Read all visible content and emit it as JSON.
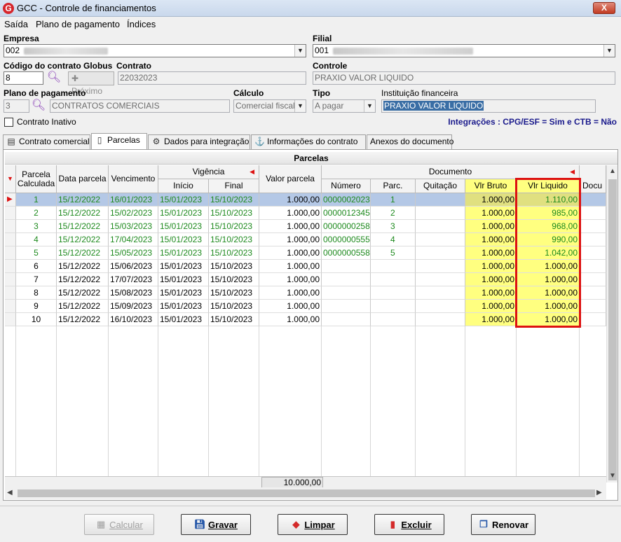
{
  "window": {
    "title": "GCC - Controle de financiamentos",
    "close_label": "X"
  },
  "menu": [
    {
      "label": "Saída"
    },
    {
      "label": "Plano de pagamento"
    },
    {
      "label": "Índices"
    }
  ],
  "form": {
    "empresa_label": "Empresa",
    "empresa_value": "002",
    "filial_label": "Filial",
    "filial_value": "001",
    "codigo_label": "Código do contrato Globus",
    "codigo_value": "8",
    "proximo_label": "Próximo",
    "contrato_label": "Contrato",
    "contrato_value": "22032023",
    "controle_label": "Controle",
    "controle_value": "PRAXIO VALOR LIQUIDO",
    "plano_label": "Plano de pagamento",
    "plano_code": "3",
    "plano_value": "CONTRATOS COMERCIAIS",
    "calculo_label": "Cálculo",
    "calculo_value": "Comercial fiscal",
    "tipo_label": "Tipo",
    "tipo_value": "A pagar",
    "instituicao_label": "Instituição financeira",
    "instituicao_value": "PRAXIO VALOR LIQUIDO",
    "contrato_inativo_label": "Contrato Inativo",
    "integracoes_text": "Integrações : CPG/ESF = Sim e CTB = Não"
  },
  "tabs": [
    {
      "label": "Contrato comercial",
      "icon": "document-icon"
    },
    {
      "label": "Parcelas",
      "icon": "page-icon"
    },
    {
      "label": "Dados para integração",
      "icon": "gear-icon"
    },
    {
      "label": "Informações do contrato",
      "icon": "anchor-icon"
    },
    {
      "label": "Anexos do documento",
      "icon": ""
    }
  ],
  "grid": {
    "title": "Parcelas",
    "headers": {
      "parcela": "Parcela Calculada",
      "data_parcela": "Data parcela",
      "vencimento": "Vencimento",
      "vigencia": "Vigência",
      "inicio": "Início",
      "final": "Final",
      "valor_parcela": "Valor parcela",
      "documento": "Documento",
      "numero": "Número",
      "parc": "Parc.",
      "quitacao": "Quitação",
      "vlr_bruto": "Vlr Bruto",
      "vlr_liquido": "Vlr Liquido",
      "docu": "Docu"
    },
    "rows": [
      {
        "parcela": "1",
        "data": "15/12/2022",
        "venc": "16/01/2023",
        "inicio": "15/01/2023",
        "final": "15/10/2023",
        "valor": "1.000,00",
        "numero": "0000002023",
        "parc": "1",
        "quit": "",
        "bruto": "1.000,00",
        "liquido": "1.110,00",
        "green": true,
        "selected": true
      },
      {
        "parcela": "2",
        "data": "15/12/2022",
        "venc": "15/02/2023",
        "inicio": "15/01/2023",
        "final": "15/10/2023",
        "valor": "1.000,00",
        "numero": "0000012345",
        "parc": "2",
        "quit": "",
        "bruto": "1.000,00",
        "liquido": "985,00",
        "green": true,
        "selected": false
      },
      {
        "parcela": "3",
        "data": "15/12/2022",
        "venc": "15/03/2023",
        "inicio": "15/01/2023",
        "final": "15/10/2023",
        "valor": "1.000,00",
        "numero": "0000000258",
        "parc": "3",
        "quit": "",
        "bruto": "1.000,00",
        "liquido": "968,00",
        "green": true,
        "selected": false
      },
      {
        "parcela": "4",
        "data": "15/12/2022",
        "venc": "17/04/2023",
        "inicio": "15/01/2023",
        "final": "15/10/2023",
        "valor": "1.000,00",
        "numero": "0000000555",
        "parc": "4",
        "quit": "",
        "bruto": "1.000,00",
        "liquido": "990,00",
        "green": true,
        "selected": false
      },
      {
        "parcela": "5",
        "data": "15/12/2022",
        "venc": "15/05/2023",
        "inicio": "15/01/2023",
        "final": "15/10/2023",
        "valor": "1.000,00",
        "numero": "0000000558",
        "parc": "5",
        "quit": "",
        "bruto": "1.000,00",
        "liquido": "1.042,00",
        "green": true,
        "selected": false
      },
      {
        "parcela": "6",
        "data": "15/12/2022",
        "venc": "15/06/2023",
        "inicio": "15/01/2023",
        "final": "15/10/2023",
        "valor": "1.000,00",
        "numero": "",
        "parc": "",
        "quit": "",
        "bruto": "1.000,00",
        "liquido": "1.000,00",
        "green": false,
        "selected": false
      },
      {
        "parcela": "7",
        "data": "15/12/2022",
        "venc": "17/07/2023",
        "inicio": "15/01/2023",
        "final": "15/10/2023",
        "valor": "1.000,00",
        "numero": "",
        "parc": "",
        "quit": "",
        "bruto": "1.000,00",
        "liquido": "1.000,00",
        "green": false,
        "selected": false
      },
      {
        "parcela": "8",
        "data": "15/12/2022",
        "venc": "15/08/2023",
        "inicio": "15/01/2023",
        "final": "15/10/2023",
        "valor": "1.000,00",
        "numero": "",
        "parc": "",
        "quit": "",
        "bruto": "1.000,00",
        "liquido": "1.000,00",
        "green": false,
        "selected": false
      },
      {
        "parcela": "9",
        "data": "15/12/2022",
        "venc": "15/09/2023",
        "inicio": "15/01/2023",
        "final": "15/10/2023",
        "valor": "1.000,00",
        "numero": "",
        "parc": "",
        "quit": "",
        "bruto": "1.000,00",
        "liquido": "1.000,00",
        "green": false,
        "selected": false
      },
      {
        "parcela": "10",
        "data": "15/12/2022",
        "venc": "16/10/2023",
        "inicio": "15/01/2023",
        "final": "15/10/2023",
        "valor": "1.000,00",
        "numero": "",
        "parc": "",
        "quit": "",
        "bruto": "1.000,00",
        "liquido": "1.000,00",
        "green": false,
        "selected": false
      }
    ],
    "total": "10.000,00"
  },
  "footer": {
    "calcular": "Calcular",
    "gravar": "Gravar",
    "limpar": "Limpar",
    "excluir": "Excluir",
    "renovar": "Renovar"
  },
  "colors": {
    "green_text": "#1e8a1e",
    "highlight_yellow": "#ffff80",
    "selection_blue": "#b4c8e6",
    "red_box": "#dd1111",
    "integration_text": "#1a1a8c"
  }
}
